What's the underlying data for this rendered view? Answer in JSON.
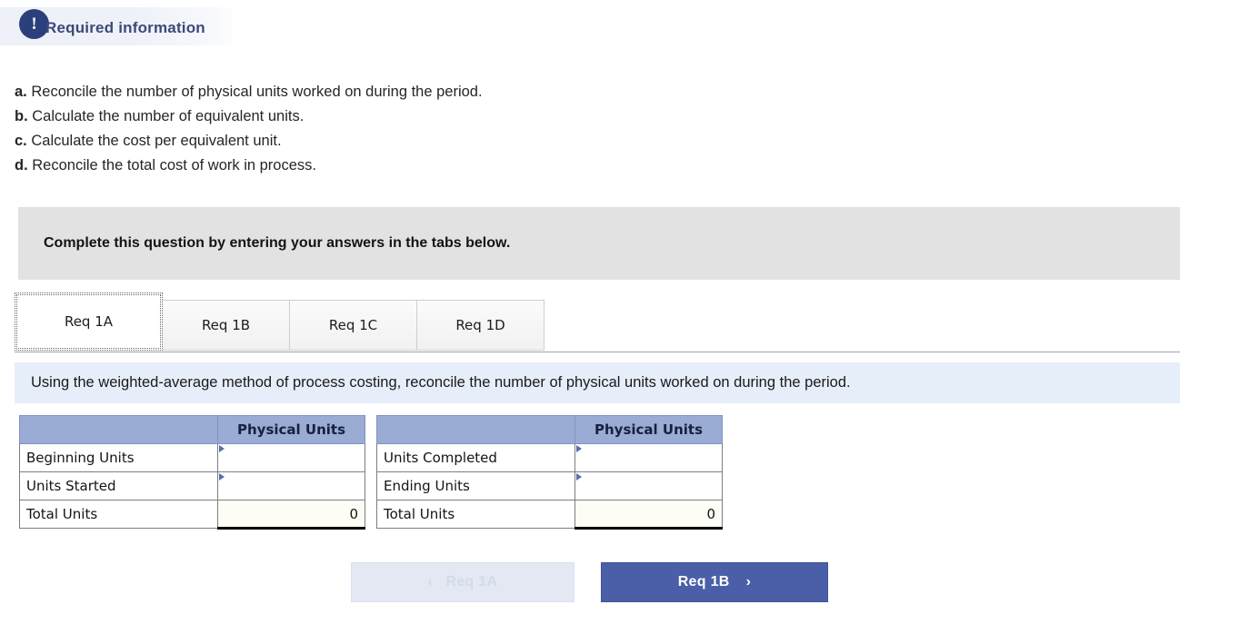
{
  "banner": {
    "icon": "exclamation-icon",
    "title": "Required information"
  },
  "requirements": [
    {
      "label": "a.",
      "text": "Reconcile the number of physical units worked on during the period."
    },
    {
      "label": "b.",
      "text": "Calculate the number of equivalent units."
    },
    {
      "label": "c.",
      "text": "Calculate the cost per equivalent unit."
    },
    {
      "label": "d.",
      "text": "Reconcile the total cost of work in process."
    }
  ],
  "instruction_strip": {
    "text": "Complete this question by entering your answers in the tabs below."
  },
  "tabs": [
    {
      "label": "Req 1A",
      "active": true
    },
    {
      "label": "Req 1B",
      "active": false
    },
    {
      "label": "Req 1C",
      "active": false
    },
    {
      "label": "Req 1D",
      "active": false
    }
  ],
  "prompt": {
    "text": "Using the weighted-average method of process costing, reconcile the number of physical units worked on during the period."
  },
  "tables": {
    "left": {
      "header_blank": "",
      "header_units": "Physical Units",
      "rows": [
        {
          "label": "Beginning Units",
          "value": "",
          "type": "input"
        },
        {
          "label": "Units Started",
          "value": "",
          "type": "input"
        },
        {
          "label": "Total Units",
          "value": "0",
          "type": "total"
        }
      ]
    },
    "right": {
      "header_blank": "",
      "header_units": "Physical Units",
      "rows": [
        {
          "label": "Units Completed",
          "value": "",
          "type": "input"
        },
        {
          "label": "Ending Units",
          "value": "",
          "type": "input"
        },
        {
          "label": "Total Units",
          "value": "0",
          "type": "total"
        }
      ]
    }
  },
  "nav": {
    "prev_label": "Req 1A",
    "prev_chevron": "‹",
    "prev_disabled": true,
    "next_label": "Req 1B",
    "next_chevron": "›"
  },
  "colors": {
    "badge_navy": "#2b3f7a",
    "title_blue": "#3b4a77",
    "gray_strip": "#e2e2e2",
    "blue_banner": "#e6eefa",
    "table_header_blue": "#9aabd4",
    "primary_button": "#4a5fa8",
    "disabled_button": "#e3e8f2"
  }
}
